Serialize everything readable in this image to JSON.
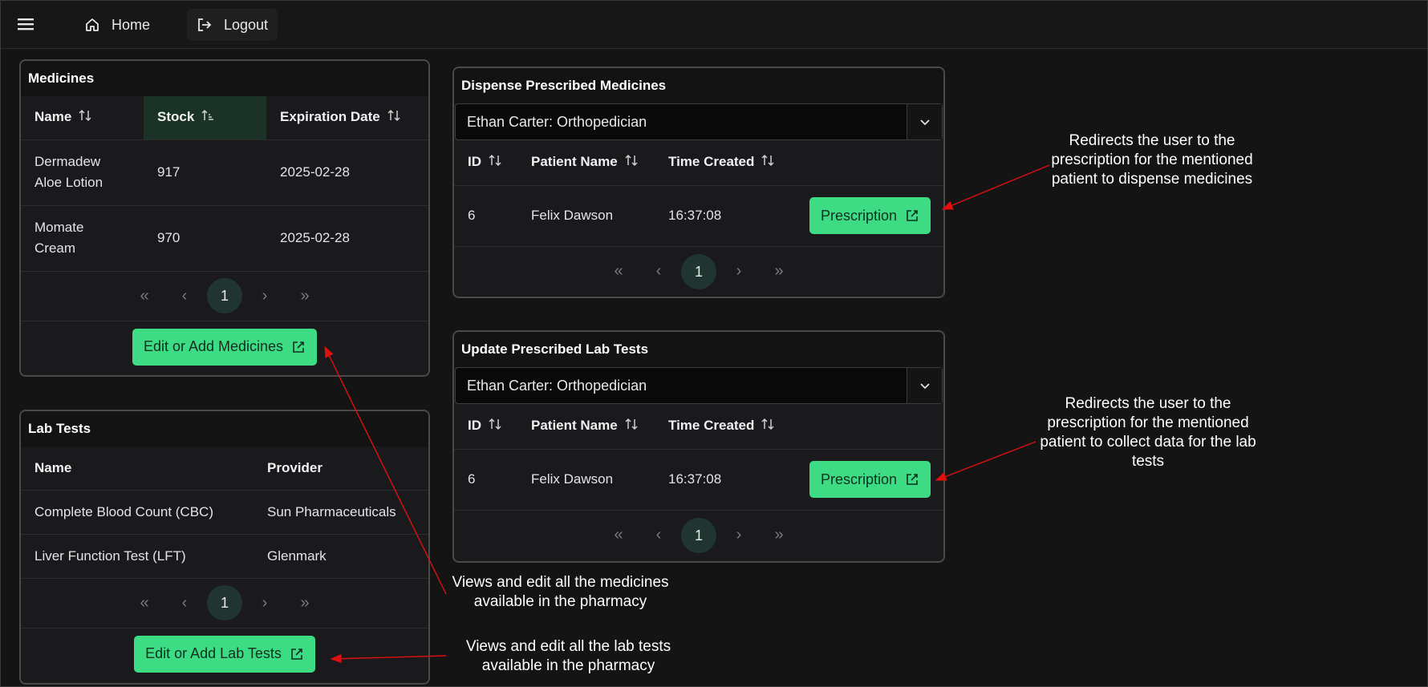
{
  "nav": {
    "home_label": "Home",
    "logout_label": "Logout"
  },
  "medicines": {
    "title": "Medicines",
    "columns": [
      "Name",
      "Stock",
      "Expiration Date"
    ],
    "rows": [
      {
        "name_line1": "Dermadew",
        "name_line2": "Aloe Lotion",
        "stock": "917",
        "expiry": "2025-02-28"
      },
      {
        "name_line1": "Momate",
        "name_line2": "Cream",
        "stock": "970",
        "expiry": "2025-02-28"
      }
    ],
    "page": "1",
    "button_label": "Edit or Add Medicines"
  },
  "lab_tests": {
    "title": "Lab Tests",
    "columns": [
      "Name",
      "Provider"
    ],
    "rows": [
      {
        "name": "Complete Blood Count (CBC)",
        "provider": "Sun Pharmaceuticals"
      },
      {
        "name": "Liver Function Test (LFT)",
        "provider": "Glenmark"
      }
    ],
    "page": "1",
    "button_label": "Edit or Add Lab Tests"
  },
  "dispense": {
    "title": "Dispense Prescribed Medicines",
    "select_value": "Ethan Carter: Orthopedician",
    "columns": [
      "ID",
      "Patient Name",
      "Time Created"
    ],
    "rows": [
      {
        "id": "6",
        "patient": "Felix Dawson",
        "time": "16:37:08",
        "button": "Prescription"
      }
    ],
    "page": "1"
  },
  "lab_update": {
    "title": "Update Prescribed Lab Tests",
    "select_value": "Ethan Carter: Orthopedician",
    "columns": [
      "ID",
      "Patient Name",
      "Time Created"
    ],
    "rows": [
      {
        "id": "6",
        "patient": "Felix Dawson",
        "time": "16:37:08",
        "button": "Prescription"
      }
    ],
    "page": "1"
  },
  "annotations": {
    "dispense_note": [
      "Redirects the user to the",
      "prescription for the mentioned",
      "patient to dispense medicines"
    ],
    "lab_note": [
      "Redirects the user to the",
      "prescription for the mentioned",
      "patient to collect data for the lab",
      "tests"
    ],
    "medicines_note": [
      "Views and edit all the medicines",
      "available in the pharmacy"
    ],
    "labtests_note": [
      "Views and edit all the lab tests",
      "available in the pharmacy"
    ]
  },
  "colors": {
    "accent": "#3ddc84",
    "background": "#141414",
    "arrow": "#e01010"
  },
  "icons": [
    "menu-icon",
    "home-icon",
    "logout-icon",
    "sort-icon",
    "external-link-icon",
    "chevron-down-icon"
  ]
}
